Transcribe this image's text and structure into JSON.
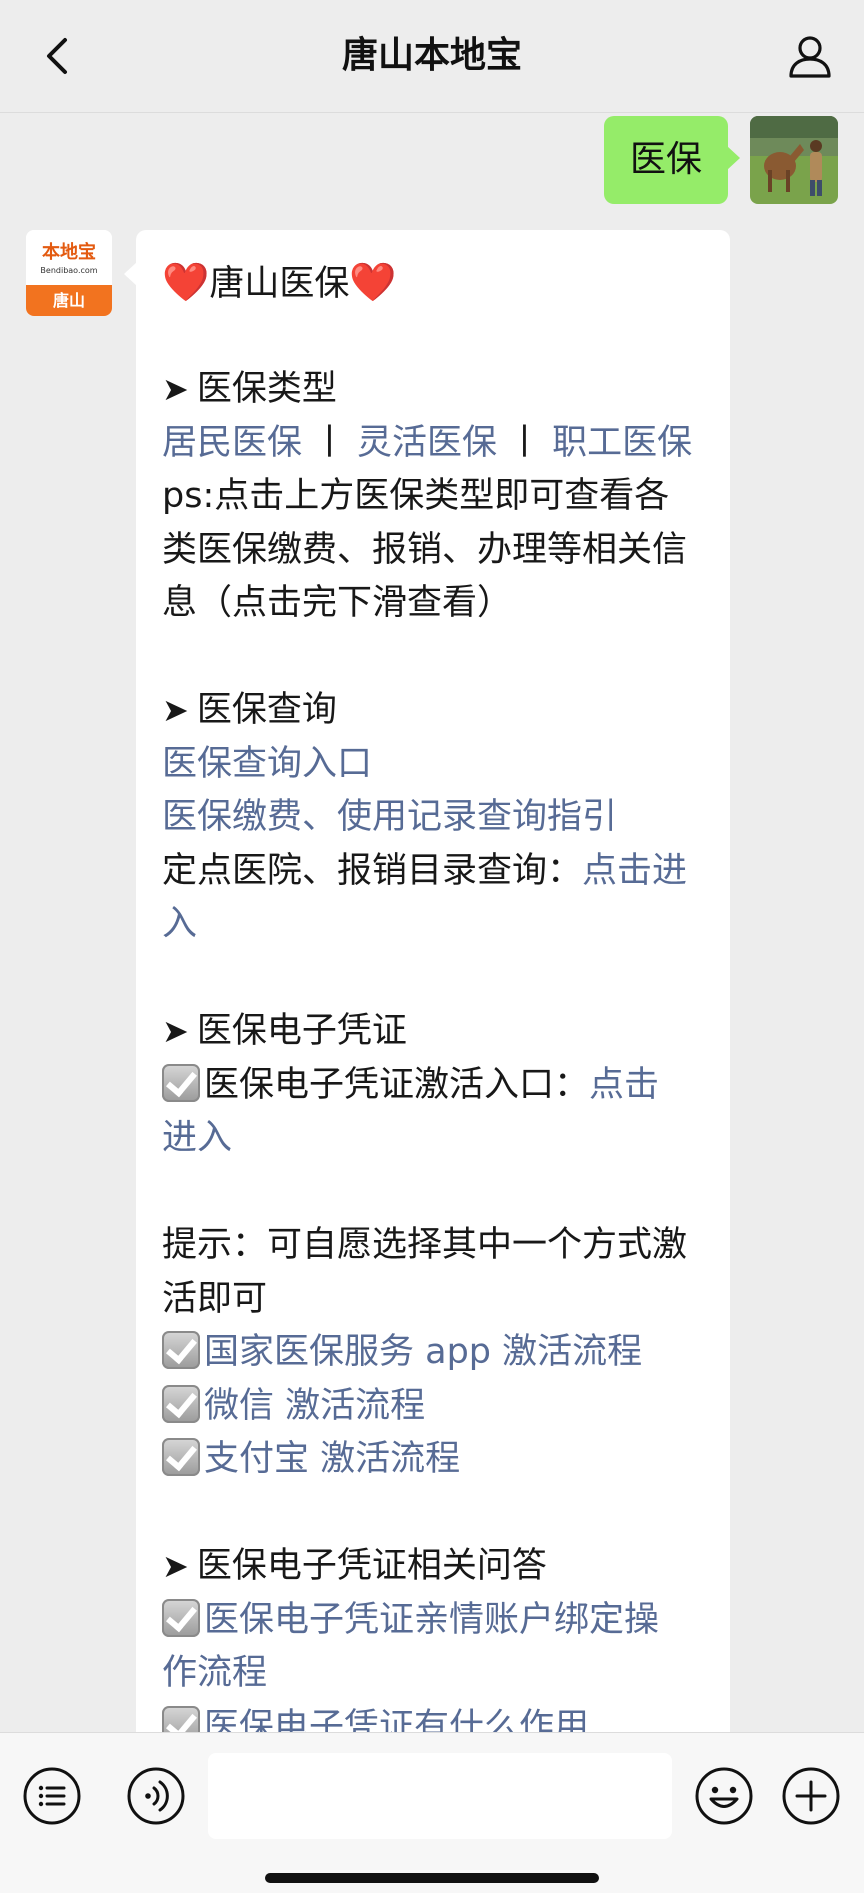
{
  "header": {
    "title": "唐山本地宝"
  },
  "sent_message": {
    "text": "医保"
  },
  "sender_avatar": {
    "logo_text": "本地宝",
    "logo_url": "Bendibao.com",
    "logo_city": "唐山"
  },
  "message": {
    "title": "唐山医保",
    "heart": "❤️",
    "arrow": "➤",
    "section1_heading": "医保类型",
    "section1_links": [
      "居民医保",
      "灵活医保",
      "职工医保"
    ],
    "section1_separator": "丨",
    "section1_note_lines": [
      "ps:点击上方医保类型即可查看各",
      "类医保缴费、报销、办理等相关信",
      "息（点击完下滑查看）"
    ],
    "section2_heading": "医保查询",
    "section2_link1": "医保查询入口",
    "section2_link2": "医保缴费、使用记录查询指引",
    "section2_text3": "定点医院、报销目录查询：",
    "section2_link3_part1": "点击进",
    "section2_link3_part2": "入",
    "section3_heading": "医保电子凭证",
    "section3_text": "医保电子凭证激活入口：",
    "section3_link_part1": "点击",
    "section3_link_part2": "进入",
    "tip_line1": "提示：可自愿选择其中一个方式激",
    "tip_line2": "活即可",
    "activation_links": [
      "国家医保服务 app 激活流程",
      "微信 激活流程",
      "支付宝 激活流程"
    ],
    "section4_heading": "医保电子凭证相关问答",
    "qa_link1_part1": "医保电子凭证亲情账户绑定操",
    "qa_link1_part2": "作流程",
    "qa_link2": "医保电子凭证有什么作用"
  },
  "input_bar": {
    "placeholder": ""
  },
  "icons": {
    "back": "back-chevron-icon",
    "user": "user-profile-icon",
    "menu": "menu-list-icon",
    "voice": "voice-icon",
    "emoji": "emoji-icon",
    "plus": "plus-icon",
    "check": "checkbox-checked-icon"
  },
  "colors": {
    "sent_bubble": "#95ec69",
    "link": "#576b95",
    "background": "#ededed"
  }
}
